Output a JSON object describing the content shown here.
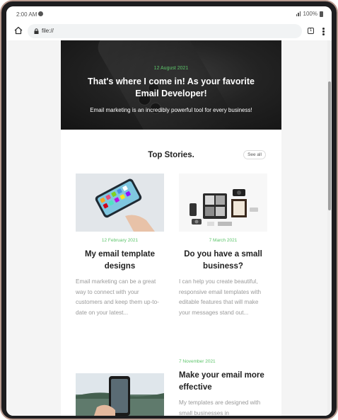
{
  "status": {
    "time": "2:00 AM",
    "battery": "100%"
  },
  "browser": {
    "url": "file://",
    "tab_count": "1"
  },
  "hero": {
    "date": "12 August 2021",
    "title": "That's where I come in! As your favorite Email Developer!",
    "subtitle": "Email marketing is an incredibly powerful tool for every business!"
  },
  "top_stories": {
    "title": "Top Stories.",
    "see_all": "See all"
  },
  "stories": [
    {
      "date": "12 February 2021",
      "title": "My email template designs",
      "excerpt": "Email marketing can be a great way to connect with your customers and keep them up-to-date on your latest..."
    },
    {
      "date": "7 March 2021",
      "title": "Do you have a small business?",
      "excerpt": "I can help you create beautiful, responsive email templates with editable features that will make your messages stand out..."
    },
    {
      "date": "7 November 2021",
      "title": "Make your email more effective",
      "excerpt": "My templates are designed with small businesses in"
    }
  ],
  "colors": {
    "accent_green": "#5cc46a",
    "frame": "#b89a8f"
  }
}
